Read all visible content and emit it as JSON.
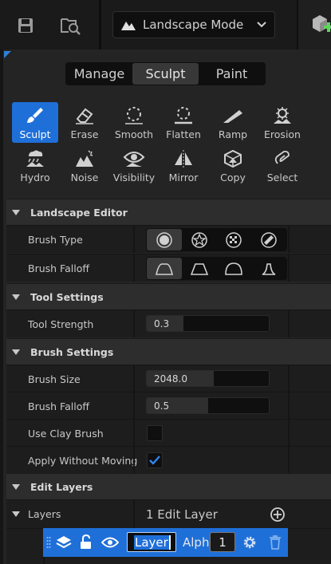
{
  "toolbar": {
    "mode_label": "Landscape Mode",
    "icons": [
      "save-icon",
      "folder-search-icon",
      "landscape-icon",
      "chevron-down-icon",
      "add-actor-icon"
    ]
  },
  "tabs": [
    {
      "label": "Manage",
      "active": false
    },
    {
      "label": "Sculpt",
      "active": true
    },
    {
      "label": "Paint",
      "active": false
    }
  ],
  "tools": [
    {
      "label": "Sculpt",
      "icon": "sculpt-brush-icon",
      "active": true
    },
    {
      "label": "Erase",
      "icon": "eraser-icon"
    },
    {
      "label": "Smooth",
      "icon": "smooth-icon"
    },
    {
      "label": "Flatten",
      "icon": "flatten-icon"
    },
    {
      "label": "Ramp",
      "icon": "ramp-icon"
    },
    {
      "label": "Erosion",
      "icon": "erosion-icon"
    },
    {
      "label": "Hydro",
      "icon": "hydro-icon"
    },
    {
      "label": "Noise",
      "icon": "noise-icon"
    },
    {
      "label": "Visibility",
      "icon": "visibility-icon"
    },
    {
      "label": "Mirror",
      "icon": "mirror-icon"
    },
    {
      "label": "Copy",
      "icon": "copy-icon"
    },
    {
      "label": "Select",
      "icon": "select-icon"
    }
  ],
  "sections": {
    "landscape_editor": "Landscape Editor",
    "tool_settings": "Tool Settings",
    "brush_settings": "Brush Settings",
    "edit_layers": "Edit Layers"
  },
  "properties": {
    "brush_type": {
      "label": "Brush Type",
      "options": [
        "circle-brush-icon",
        "alpha-brush-icon",
        "pattern-brush-icon",
        "component-brush-icon"
      ],
      "selected": 0
    },
    "brush_falloff_type": {
      "label": "Brush Falloff",
      "options": [
        "smooth-falloff-icon",
        "linear-falloff-icon",
        "spherical-falloff-icon",
        "tip-falloff-icon"
      ],
      "selected": 0
    },
    "tool_strength": {
      "label": "Tool Strength",
      "value": "0.3",
      "fraction": 0.3
    },
    "brush_size": {
      "label": "Brush Size",
      "value": "2048.0",
      "fraction": 0.55
    },
    "brush_falloff": {
      "label": "Brush Falloff",
      "value": "0.5",
      "fraction": 0.5
    },
    "use_clay_brush": {
      "label": "Use Clay Brush",
      "checked": false
    },
    "apply_without_moving": {
      "label": "Apply Without Moving",
      "checked": true
    }
  },
  "layers": {
    "label": "Layers",
    "count_text": "1 Edit Layer",
    "items": [
      {
        "name": "Layer",
        "alpha_label": "Alph",
        "alpha_value": "1"
      }
    ]
  },
  "colors": {
    "accent": "#1f6fd8",
    "panel": "#242424",
    "row": "#1d1d1d"
  }
}
